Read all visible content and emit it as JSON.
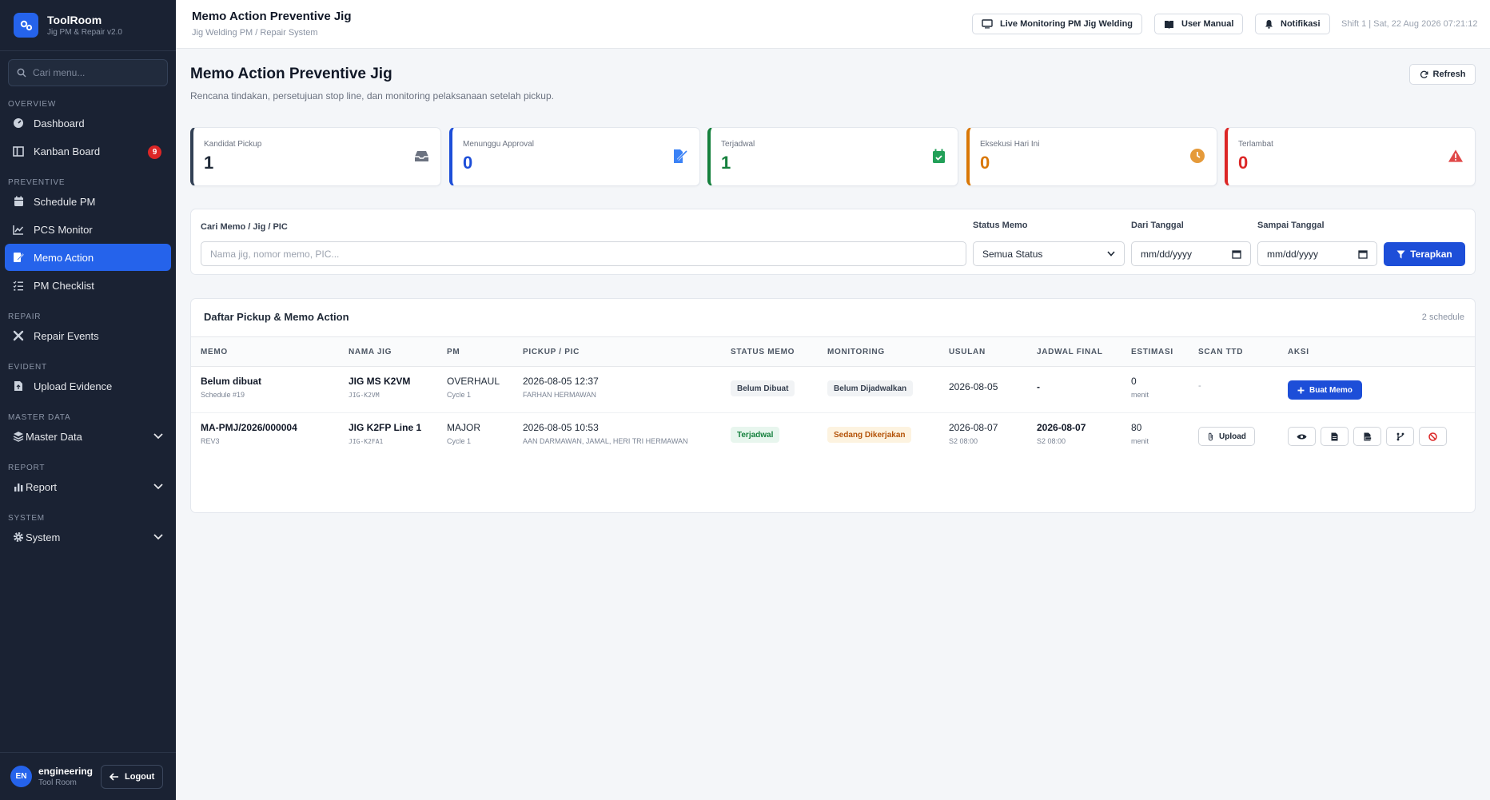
{
  "brand": {
    "title": "ToolRoom",
    "subtitle": "Jig PM & Repair v2.0"
  },
  "sidebar": {
    "search_placeholder": "Cari menu...",
    "sections": {
      "overview": "OVERVIEW",
      "preventive": "PREVENTIVE",
      "repair": "REPAIR",
      "evident": "EVIDENT",
      "master": "MASTER DATA",
      "report": "REPORT",
      "system": "SYSTEM"
    },
    "items": {
      "dashboard": "Dashboard",
      "kanban": "Kanban Board",
      "kanban_badge": "9",
      "schedule": "Schedule PM",
      "pcs": "PCS Monitor",
      "memo": "Memo Action",
      "checklist": "PM Checklist",
      "repair_events": "Repair Events",
      "upload": "Upload Evidence",
      "master": "Master Data",
      "report": "Report",
      "system": "System"
    },
    "user": {
      "initials": "EN",
      "name": "engineering",
      "role": "Tool Room",
      "logout": "Logout"
    }
  },
  "topbar": {
    "title": "Memo Action Preventive Jig",
    "subtitle": "Jig Welding PM / Repair System",
    "live_monitoring": "Live Monitoring PM Jig Welding",
    "user_manual": "User Manual",
    "notifikasi": "Notifikasi",
    "shift_date": "Shift 1 | Sat, 22 Aug 2026 07:21:12"
  },
  "page": {
    "title": "Memo Action Preventive Jig",
    "description": "Rencana tindakan, persetujuan stop line, dan monitoring pelaksanaan setelah pickup.",
    "refresh": "Refresh"
  },
  "stats": [
    {
      "label": "Kandidat Pickup",
      "value": "1",
      "color": "#1f2937",
      "icon": "inbox-icon"
    },
    {
      "label": "Menunggu Approval",
      "value": "0",
      "color": "#1d4ed8",
      "icon": "signature-icon"
    },
    {
      "label": "Terjadwal",
      "value": "1",
      "color": "#15803d",
      "icon": "calendar-check-icon"
    },
    {
      "label": "Eksekusi Hari Ini",
      "value": "0",
      "color": "#d97706",
      "icon": "clock-icon"
    },
    {
      "label": "Terlambat",
      "value": "0",
      "color": "#dc2626",
      "icon": "warning-icon"
    }
  ],
  "filters": {
    "search_label": "Cari Memo / Jig / PIC",
    "search_placeholder": "Nama jig, nomor memo, PIC...",
    "status_label": "Status Memo",
    "status_value": "Semua Status",
    "from_label": "Dari Tanggal",
    "from_placeholder": "mm/dd/yyyy",
    "to_label": "Sampai Tanggal",
    "to_placeholder": "mm/dd/yyyy",
    "apply": "Terapkan"
  },
  "table": {
    "title": "Daftar Pickup & Memo Action",
    "count": "2 schedule",
    "columns": [
      "MEMO",
      "NAMA JIG",
      "PM",
      "PICKUP / PIC",
      "STATUS MEMO",
      "MONITORING",
      "USULAN",
      "JADWAL FINAL",
      "ESTIMASI",
      "SCAN TTD",
      "AKSI"
    ],
    "rows": [
      {
        "memo": "Belum dibuat",
        "memo_sub": "Schedule #19",
        "jig": "JIG MS K2VM",
        "jig_code": "JIG-K2VM",
        "pm": "OVERHAUL",
        "pm_sub": "Cycle 1",
        "pickup": "2026-08-05 12:37",
        "pic": "FARHAN HERMAWAN",
        "status": "Belum Dibuat",
        "monitoring": "Belum Dijadwalkan",
        "usulan": "2026-08-05",
        "usulan_sub": "",
        "jadwal": "-",
        "jadwal_sub": "",
        "estimasi": "0",
        "estimasi_unit": "menit",
        "scan": "-",
        "action": "Buat Memo"
      },
      {
        "memo": "MA-PMJ/2026/000004",
        "memo_sub": "REV3",
        "jig": "JIG K2FP Line 1",
        "jig_code": "JIG-K2FA1",
        "pm": "MAJOR",
        "pm_sub": "Cycle 1",
        "pickup": "2026-08-05 10:53",
        "pic": "AAN DARMAWAN, JAMAL, HERI TRI HERMAWAN",
        "status": "Terjadwal",
        "monitoring": "Sedang Dikerjakan",
        "usulan": "2026-08-07",
        "usulan_sub": "S2 08:00",
        "jadwal": "2026-08-07",
        "jadwal_sub": "S2 08:00",
        "estimasi": "80",
        "estimasi_unit": "menit",
        "scan": "Upload",
        "action_icons": [
          "eye-icon",
          "file-icon",
          "pdf-icon",
          "branch-icon",
          "cancel-icon"
        ]
      }
    ]
  },
  "colors": {
    "sidebar_bg": "#1a2233",
    "primary": "#2563eb",
    "badge_red": "#dc2626",
    "success": "#15803d",
    "warning": "#d97706"
  }
}
